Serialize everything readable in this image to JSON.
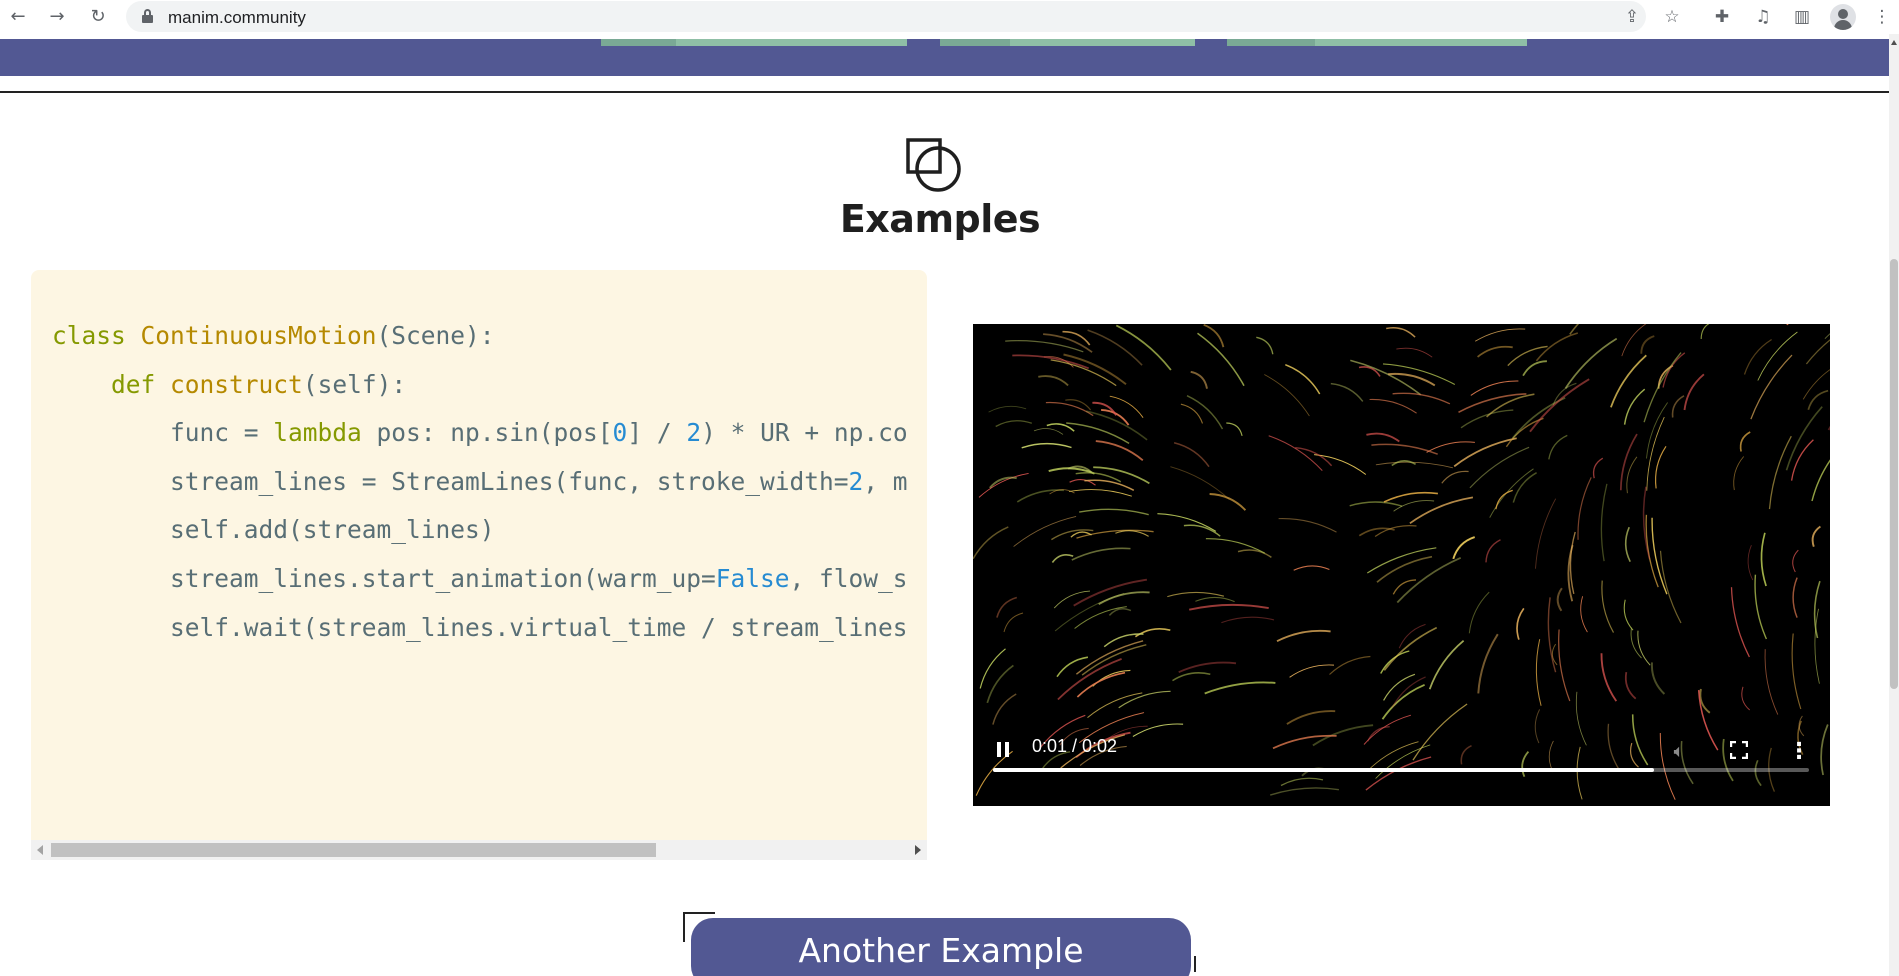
{
  "browser": {
    "url": "manim.community",
    "icons": [
      "back-icon",
      "forward-icon",
      "reload-icon",
      "lock-icon",
      "share-icon",
      "star-icon",
      "extensions-icon",
      "media-icon",
      "side-panel-icon",
      "profile-icon",
      "menu-icon"
    ]
  },
  "section": {
    "title": "Examples",
    "icon": "shapes-icon"
  },
  "code": {
    "lines": [
      "class ContinuousMotion(Scene):",
      "    def construct(self):",
      "        func = lambda pos: np.sin(pos[0] / 2) * UR + np.co",
      "        stream_lines = StreamLines(func, stroke_width=2, m",
      "        self.add(stream_lines)",
      "        stream_lines.start_animation(warm_up=False, flow_s",
      "        self.wait(stream_lines.virtual_time / stream_lines"
    ],
    "scroll_fraction": 0.56
  },
  "video": {
    "time": "0:01 / 0:02",
    "progress": 0.81,
    "controls": [
      "pause-icon",
      "volume-icon",
      "fullscreen-icon",
      "more-icon"
    ]
  },
  "button": {
    "label": "Another Example"
  },
  "colors": {
    "banner": "#525893",
    "code_bg": "#fdf6e3",
    "code_keyword": "#859900",
    "code_class": "#b58900",
    "code_number": "#268bd2"
  }
}
